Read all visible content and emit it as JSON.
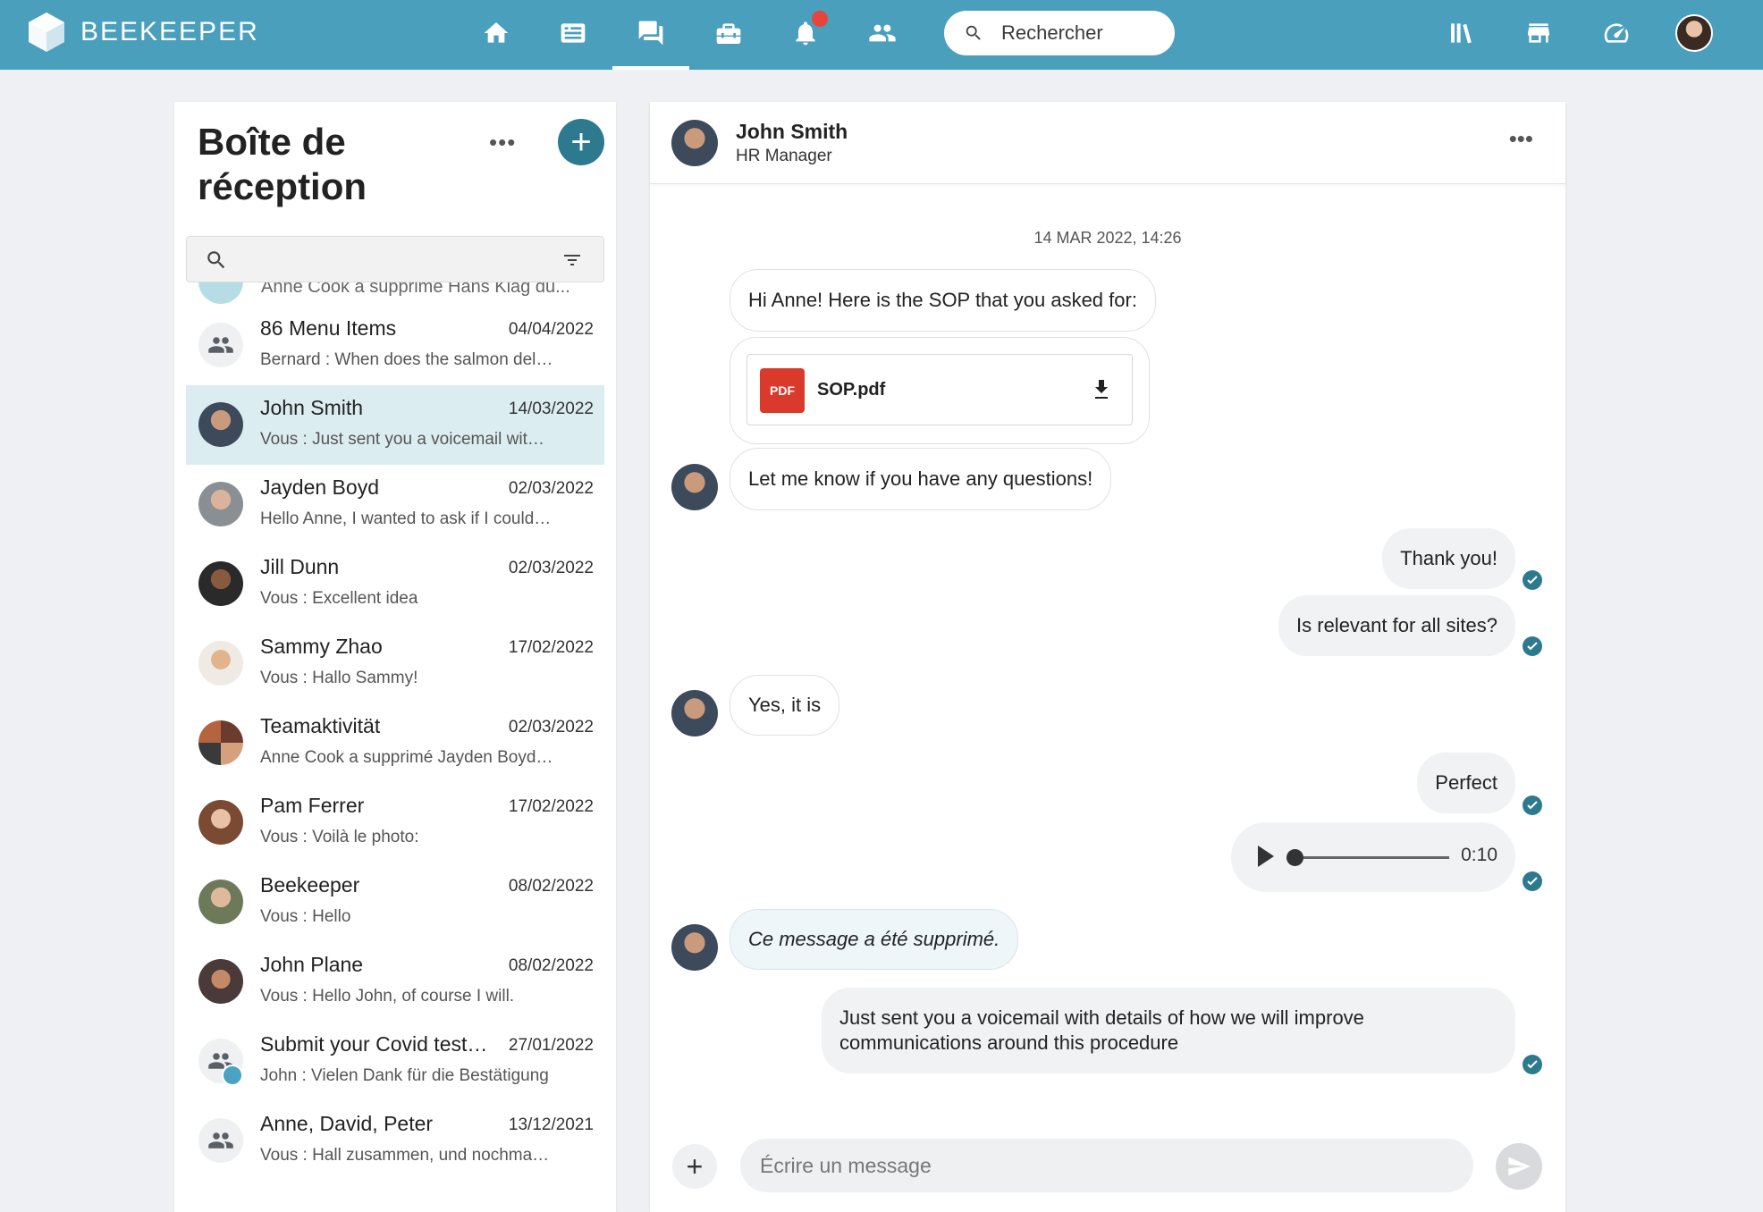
{
  "brand": {
    "name": "BEEKEEPER",
    "accent": "#4a9fbc",
    "primary_dark": "#2d7a8e",
    "notification_red": "#e8443b"
  },
  "topnav": {
    "icons": [
      "home-icon",
      "news-icon",
      "chat-icon",
      "toolbox-icon",
      "bell-icon",
      "people-icon"
    ],
    "active": "chat-icon",
    "search_placeholder": "Rechercher",
    "right_icons": [
      "library-icon",
      "store-icon",
      "gauge-icon"
    ]
  },
  "inbox": {
    "title": "Boîte de réception",
    "more_label": "•••",
    "new_label": "+",
    "partial_preview": "Anne Cook a supprimé Hans Klag du...",
    "conversations": [
      {
        "name": "86 Menu Items",
        "date": "04/04/2022",
        "preview": "Bernard : When does the salmon del…",
        "avatar": "group"
      },
      {
        "name": "John Smith",
        "date": "14/03/2022",
        "preview": "Vous : Just sent you a voicemail wit…",
        "avatar": "person",
        "active": true
      },
      {
        "name": "Jayden Boyd",
        "date": "02/03/2022",
        "preview": "Hello Anne, I wanted to ask if I could…",
        "avatar": "person"
      },
      {
        "name": "Jill Dunn",
        "date": "02/03/2022",
        "preview": "Vous : Excellent idea",
        "avatar": "person"
      },
      {
        "name": "Sammy Zhao",
        "date": "17/02/2022",
        "preview": "Vous : Hallo Sammy!",
        "avatar": "person"
      },
      {
        "name": "Teamaktivität",
        "date": "02/03/2022",
        "preview": "Anne Cook a supprimé Jayden Boyd…",
        "avatar": "person"
      },
      {
        "name": "Pam Ferrer",
        "date": "17/02/2022",
        "preview": "Vous : Voilà le photo:",
        "avatar": "person"
      },
      {
        "name": "Beekeeper",
        "date": "08/02/2022",
        "preview": "Vous : Hello",
        "avatar": "person"
      },
      {
        "name": "John Plane",
        "date": "08/02/2022",
        "preview": "Vous : Hello John, of course I will.",
        "avatar": "person"
      },
      {
        "name": "Submit your Covid test r…",
        "date": "27/01/2022",
        "preview": "John : Vielen Dank für die Bestätigung",
        "avatar": "group-announce"
      },
      {
        "name": "Anne, David, Peter",
        "date": "13/12/2021",
        "preview": "Vous : Hall zusammen, und nochma…",
        "avatar": "group"
      }
    ]
  },
  "chat": {
    "contact_name": "John Smith",
    "contact_role": "HR Manager",
    "more_label": "•••",
    "timestamp": "14 MAR 2022, 14:26",
    "messages": [
      {
        "text": "Hi Anne! Here is the SOP that you asked for:",
        "direction": "in"
      },
      {
        "file_name": "SOP.pdf",
        "file_type": "PDF",
        "direction": "in"
      },
      {
        "text": "Let me know if you have any questions!",
        "direction": "in"
      },
      {
        "text": "Thank you!",
        "direction": "out",
        "read": true
      },
      {
        "text": "Is relevant for all sites?",
        "direction": "out",
        "read": true
      },
      {
        "text": "Yes, it is",
        "direction": "in"
      },
      {
        "text": "Perfect",
        "direction": "out",
        "read": true
      },
      {
        "voice_duration": "0:10",
        "voice_progress": 0,
        "direction": "out",
        "read": true
      },
      {
        "text": "Ce message a été supprimé.",
        "direction": "in",
        "deleted": true
      },
      {
        "text": "Just sent you a voicemail with details of how we will improve communications around this procedure",
        "direction": "out",
        "read": true
      }
    ],
    "composer_placeholder": "Écrire un message"
  }
}
